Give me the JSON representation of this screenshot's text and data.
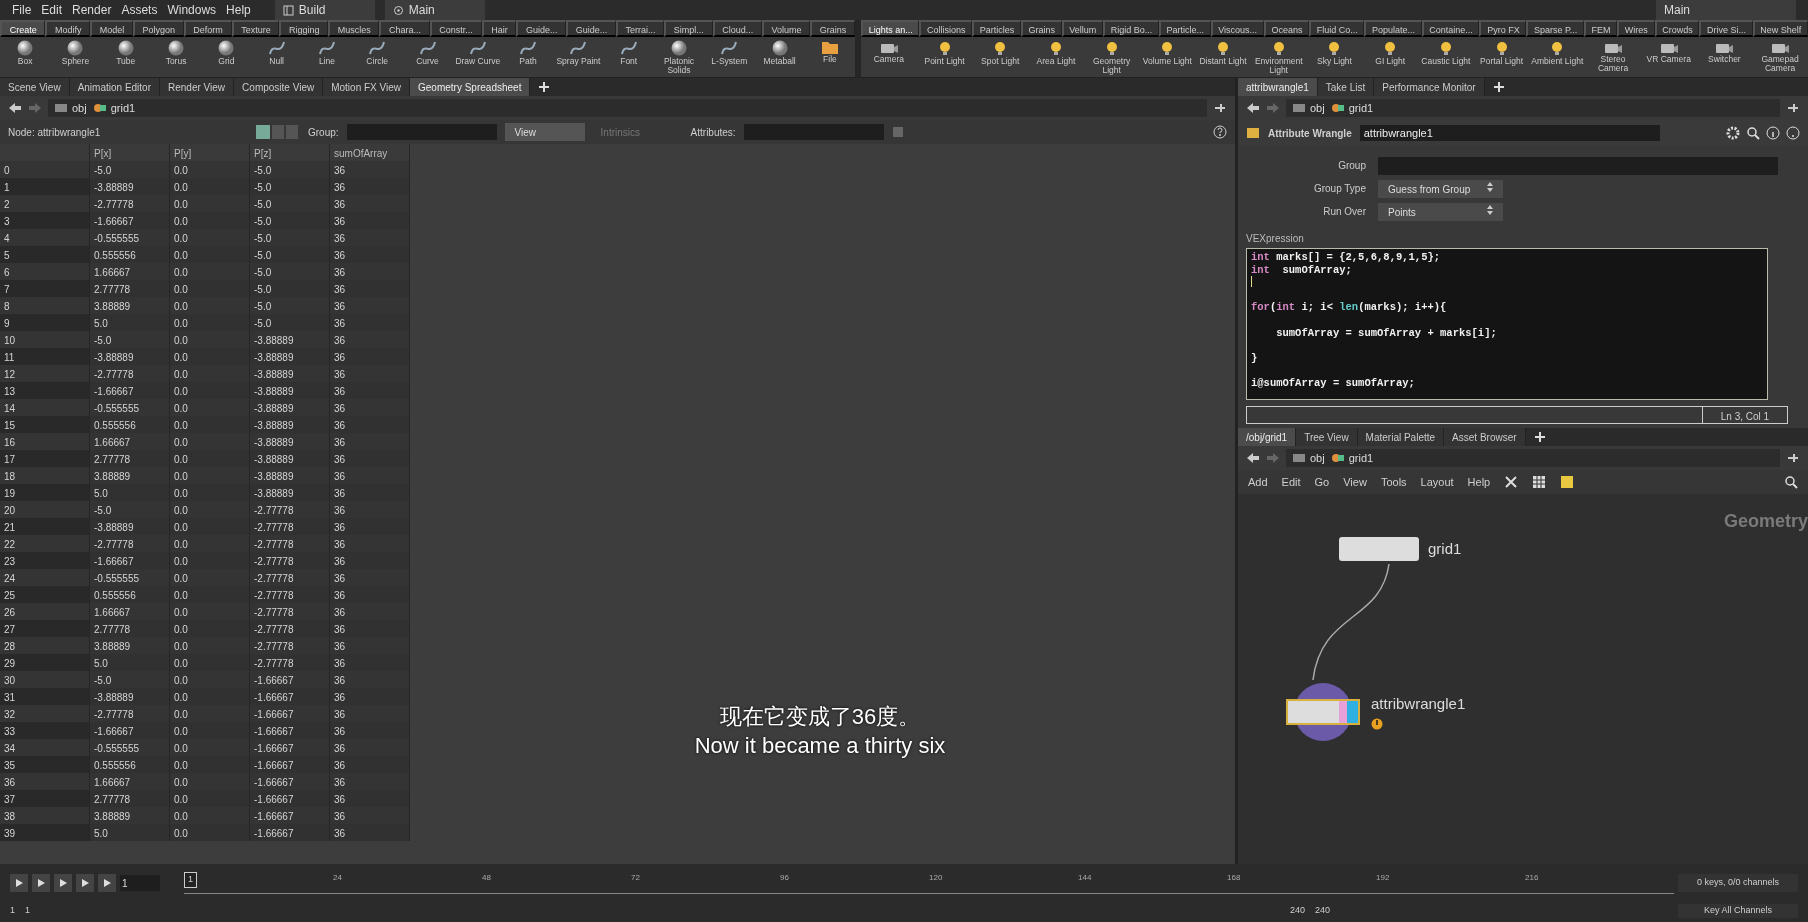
{
  "menu_bar": {
    "items": [
      "File",
      "Edit",
      "Render",
      "Assets",
      "Windows",
      "Help"
    ],
    "desktop": "Build",
    "workspace": "Main",
    "right_workspace": "Main"
  },
  "shelf_left": {
    "tabs": [
      {
        "label": "Create",
        "selected": true
      },
      {
        "label": "Modify",
        "selected": false
      },
      {
        "label": "Model",
        "selected": false
      },
      {
        "label": "Polygon",
        "selected": false
      },
      {
        "label": "Deform",
        "selected": false
      },
      {
        "label": "Texture",
        "selected": false
      },
      {
        "label": "Rigging",
        "selected": false
      },
      {
        "label": "Muscles",
        "selected": false
      },
      {
        "label": "Chara...",
        "selected": false
      },
      {
        "label": "Constr...",
        "selected": false
      },
      {
        "label": "Hair",
        "selected": false
      },
      {
        "label": "Guide...",
        "selected": false
      },
      {
        "label": "Guide...",
        "selected": false
      },
      {
        "label": "Terrai...",
        "selected": false
      },
      {
        "label": "Simpl...",
        "selected": false
      },
      {
        "label": "Cloud...",
        "selected": false
      },
      {
        "label": "Volume",
        "selected": false
      },
      {
        "label": "Grains",
        "selected": false
      }
    ],
    "tools": [
      {
        "label": "Box",
        "kind": "shape"
      },
      {
        "label": "Sphere",
        "kind": "shape"
      },
      {
        "label": "Tube",
        "kind": "shape"
      },
      {
        "label": "Torus",
        "kind": "shape"
      },
      {
        "label": "Grid",
        "kind": "shape"
      },
      {
        "label": "Null",
        "kind": "curve"
      },
      {
        "label": "Line",
        "kind": "curve"
      },
      {
        "label": "Circle",
        "kind": "curve"
      },
      {
        "label": "Curve",
        "kind": "curve"
      },
      {
        "label": "Draw Curve",
        "kind": "curve"
      },
      {
        "label": "Path",
        "kind": "curve"
      },
      {
        "label": "Spray Paint",
        "kind": "curve"
      },
      {
        "label": "Font",
        "kind": "curve"
      },
      {
        "label": "Platonic Solids",
        "kind": "shape"
      },
      {
        "label": "L-System",
        "kind": "curve"
      },
      {
        "label": "Metaball",
        "kind": "shape"
      },
      {
        "label": "File",
        "kind": "file"
      }
    ]
  },
  "shelf_right": {
    "tabs": [
      {
        "label": "Lights an...",
        "selected": true
      },
      {
        "label": "Collisions",
        "selected": false
      },
      {
        "label": "Particles",
        "selected": false
      },
      {
        "label": "Grains",
        "selected": false
      },
      {
        "label": "Vellum",
        "selected": false
      },
      {
        "label": "Rigid Bo...",
        "selected": false
      },
      {
        "label": "Particle...",
        "selected": false
      },
      {
        "label": "Viscous...",
        "selected": false
      },
      {
        "label": "Oceans",
        "selected": false
      },
      {
        "label": "Fluid Co...",
        "selected": false
      },
      {
        "label": "Populate...",
        "selected": false
      },
      {
        "label": "Containe...",
        "selected": false
      },
      {
        "label": "Pyro FX",
        "selected": false
      },
      {
        "label": "Sparse P...",
        "selected": false
      },
      {
        "label": "FEM",
        "selected": false
      },
      {
        "label": "Wires",
        "selected": false
      },
      {
        "label": "Crowds",
        "selected": false
      },
      {
        "label": "Drive Si...",
        "selected": false
      },
      {
        "label": "New Shelf",
        "selected": false
      }
    ],
    "tools": [
      {
        "label": "Camera",
        "kind": "camera"
      },
      {
        "label": "Point Light",
        "kind": "light"
      },
      {
        "label": "Spot Light",
        "kind": "light"
      },
      {
        "label": "Area Light",
        "kind": "light"
      },
      {
        "label": "Geometry Light",
        "kind": "light"
      },
      {
        "label": "Volume Light",
        "kind": "light"
      },
      {
        "label": "Distant Light",
        "kind": "light"
      },
      {
        "label": "Environment Light",
        "kind": "light"
      },
      {
        "label": "Sky Light",
        "kind": "light"
      },
      {
        "label": "GI Light",
        "kind": "light"
      },
      {
        "label": "Caustic Light",
        "kind": "light"
      },
      {
        "label": "Portal Light",
        "kind": "light"
      },
      {
        "label": "Ambient Light",
        "kind": "light"
      },
      {
        "label": "Stereo Camera",
        "kind": "camera"
      },
      {
        "label": "VR Camera",
        "kind": "camera"
      },
      {
        "label": "Switcher",
        "kind": "camera"
      },
      {
        "label": "Gamepad Camera",
        "kind": "camera"
      }
    ]
  },
  "spreadsheet_pane": {
    "tabs": [
      {
        "label": "Scene View",
        "selected": false
      },
      {
        "label": "Animation Editor",
        "selected": false
      },
      {
        "label": "Render View",
        "selected": false
      },
      {
        "label": "Composite View",
        "selected": false
      },
      {
        "label": "Motion FX View",
        "selected": false
      },
      {
        "label": "Geometry Spreadsheet",
        "selected": true
      }
    ],
    "path": [
      "obj",
      "grid1"
    ],
    "node_label": "Node: attribwrangle1",
    "group_label": "Group:",
    "view_button": "View",
    "intrinsics": {
      "label": "Intrinsics",
      "disabled": true
    },
    "attributes_label": "Attributes:",
    "table": {
      "columns": [
        "",
        "P[x]",
        "P[y]",
        "P[z]",
        "sumOfArray"
      ],
      "rows": [
        [
          "0",
          "-5.0",
          "0.0",
          "-5.0",
          "36"
        ],
        [
          "1",
          "-3.88889",
          "0.0",
          "-5.0",
          "36"
        ],
        [
          "2",
          "-2.77778",
          "0.0",
          "-5.0",
          "36"
        ],
        [
          "3",
          "-1.66667",
          "0.0",
          "-5.0",
          "36"
        ],
        [
          "4",
          "-0.555555",
          "0.0",
          "-5.0",
          "36"
        ],
        [
          "5",
          "0.555556",
          "0.0",
          "-5.0",
          "36"
        ],
        [
          "6",
          "1.66667",
          "0.0",
          "-5.0",
          "36"
        ],
        [
          "7",
          "2.77778",
          "0.0",
          "-5.0",
          "36"
        ],
        [
          "8",
          "3.88889",
          "0.0",
          "-5.0",
          "36"
        ],
        [
          "9",
          "5.0",
          "0.0",
          "-5.0",
          "36"
        ],
        [
          "10",
          "-5.0",
          "0.0",
          "-3.88889",
          "36"
        ],
        [
          "11",
          "-3.88889",
          "0.0",
          "-3.88889",
          "36"
        ],
        [
          "12",
          "-2.77778",
          "0.0",
          "-3.88889",
          "36"
        ],
        [
          "13",
          "-1.66667",
          "0.0",
          "-3.88889",
          "36"
        ],
        [
          "14",
          "-0.555555",
          "0.0",
          "-3.88889",
          "36"
        ],
        [
          "15",
          "0.555556",
          "0.0",
          "-3.88889",
          "36"
        ],
        [
          "16",
          "1.66667",
          "0.0",
          "-3.88889",
          "36"
        ],
        [
          "17",
          "2.77778",
          "0.0",
          "-3.88889",
          "36"
        ],
        [
          "18",
          "3.88889",
          "0.0",
          "-3.88889",
          "36"
        ],
        [
          "19",
          "5.0",
          "0.0",
          "-3.88889",
          "36"
        ],
        [
          "20",
          "-5.0",
          "0.0",
          "-2.77778",
          "36"
        ],
        [
          "21",
          "-3.88889",
          "0.0",
          "-2.77778",
          "36"
        ],
        [
          "22",
          "-2.77778",
          "0.0",
          "-2.77778",
          "36"
        ],
        [
          "23",
          "-1.66667",
          "0.0",
          "-2.77778",
          "36"
        ],
        [
          "24",
          "-0.555555",
          "0.0",
          "-2.77778",
          "36"
        ],
        [
          "25",
          "0.555556",
          "0.0",
          "-2.77778",
          "36"
        ],
        [
          "26",
          "1.66667",
          "0.0",
          "-2.77778",
          "36"
        ],
        [
          "27",
          "2.77778",
          "0.0",
          "-2.77778",
          "36"
        ],
        [
          "28",
          "3.88889",
          "0.0",
          "-2.77778",
          "36"
        ],
        [
          "29",
          "5.0",
          "0.0",
          "-2.77778",
          "36"
        ],
        [
          "30",
          "-5.0",
          "0.0",
          "-1.66667",
          "36"
        ],
        [
          "31",
          "-3.88889",
          "0.0",
          "-1.66667",
          "36"
        ],
        [
          "32",
          "-2.77778",
          "0.0",
          "-1.66667",
          "36"
        ],
        [
          "33",
          "-1.66667",
          "0.0",
          "-1.66667",
          "36"
        ],
        [
          "34",
          "-0.555555",
          "0.0",
          "-1.66667",
          "36"
        ],
        [
          "35",
          "0.555556",
          "0.0",
          "-1.66667",
          "36"
        ],
        [
          "36",
          "1.66667",
          "0.0",
          "-1.66667",
          "36"
        ],
        [
          "37",
          "2.77778",
          "0.0",
          "-1.66667",
          "36"
        ],
        [
          "38",
          "3.88889",
          "0.0",
          "-1.66667",
          "36"
        ],
        [
          "39",
          "5.0",
          "0.0",
          "-1.66667",
          "36"
        ]
      ]
    },
    "subtitle": [
      "现在它变成了36度。",
      "Now it became a thirty six"
    ]
  },
  "parameter_pane": {
    "tabs": [
      {
        "label": "attribwrangle1",
        "selected": true
      },
      {
        "label": "Take List",
        "selected": false
      },
      {
        "label": "Performance Monitor",
        "selected": false
      }
    ],
    "path": [
      "obj",
      "grid1"
    ],
    "node_type": "Attribute Wrangle",
    "node_name": "attribwrangle1",
    "params": [
      {
        "label": "Group",
        "kind": "text"
      },
      {
        "label": "Group Type",
        "kind": "menu",
        "value": "Guess from Group"
      },
      {
        "label": "Run Over",
        "kind": "menu",
        "value": "Points"
      }
    ],
    "vex_label": "VEXpression",
    "code": [
      {
        "kind": "text",
        "segments": [
          {
            "kind": "keyword",
            "text": "int"
          },
          {
            "kind": "plain",
            "text": " marks[] = {2,5,6,8,9,1,5};"
          }
        ]
      },
      {
        "kind": "text",
        "segments": [
          {
            "kind": "keyword",
            "text": "int"
          },
          {
            "kind": "plain",
            "text": "  sumOfArray;"
          }
        ]
      },
      {
        "kind": "caret"
      },
      {
        "kind": "blank"
      },
      {
        "kind": "text",
        "segments": [
          {
            "kind": "keyword",
            "text": "for"
          },
          {
            "kind": "plain",
            "text": "("
          },
          {
            "kind": "keyword",
            "text": "int"
          },
          {
            "kind": "plain",
            "text": " i; i< "
          },
          {
            "kind": "function",
            "text": "len"
          },
          {
            "kind": "plain",
            "text": "(marks); i++){"
          }
        ]
      },
      {
        "kind": "blank"
      },
      {
        "kind": "text",
        "segments": [
          {
            "kind": "plain",
            "text": "    sumOfArray = sumOfArray + marks[i];"
          }
        ]
      },
      {
        "kind": "blank"
      },
      {
        "kind": "text",
        "segments": [
          {
            "kind": "plain",
            "text": "}"
          }
        ]
      },
      {
        "kind": "blank"
      },
      {
        "kind": "text",
        "segments": [
          {
            "kind": "plain",
            "text": "i@sumOfArray = sumOfArray;"
          }
        ]
      }
    ],
    "status": "Ln 3, Col 1"
  },
  "network_pane": {
    "tabs": [
      {
        "label": "/obj/grid1",
        "selected": true
      },
      {
        "label": "Tree View",
        "selected": false
      },
      {
        "label": "Material Palette",
        "selected": false
      },
      {
        "label": "Asset Browser",
        "selected": false
      }
    ],
    "path": [
      "obj",
      "grid1"
    ],
    "menu": [
      "Add",
      "Edit",
      "Go",
      "View",
      "Tools",
      "Layout",
      "Help"
    ],
    "context": "Geometry",
    "nodes": [
      {
        "name": "grid1",
        "kind": "generator",
        "warning": false
      },
      {
        "name": "attribwrangle1",
        "kind": "wrangle",
        "warning": true
      }
    ]
  },
  "timeline": {
    "frame": "1",
    "marker": "1",
    "ticks": [
      "24",
      "48",
      "72",
      "96",
      "120",
      "144",
      "168",
      "192",
      "216"
    ],
    "keys": "0 keys, 0/0 channels",
    "key_all": "Key All Channels",
    "range": [
      "1",
      "1",
      "240",
      "240"
    ]
  }
}
